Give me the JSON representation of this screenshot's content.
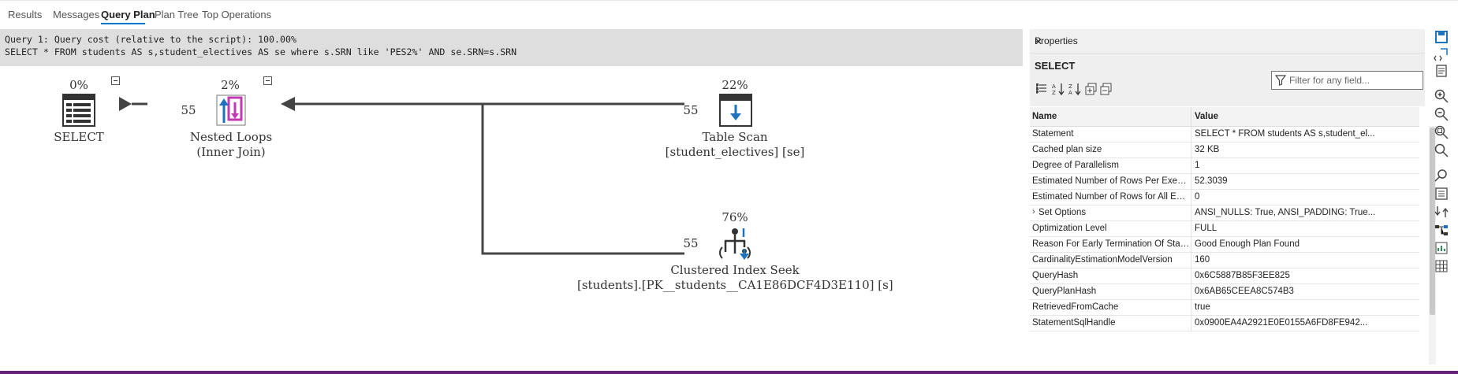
{
  "tabs": [
    {
      "label": "Results"
    },
    {
      "label": "Messages"
    },
    {
      "label": "Query Plan",
      "active": true
    },
    {
      "label": "Plan Tree"
    },
    {
      "label": "Top Operations"
    }
  ],
  "query": {
    "line1": "Query 1: Query cost (relative to the script): 100.00%",
    "line2": "SELECT * FROM students AS s,student_electives AS se where s.SRN like 'PES2%' AND se.SRN=s.SRN"
  },
  "plan": {
    "nodes": {
      "select": {
        "cost": "0%",
        "label": "SELECT",
        "icon": "select-icon"
      },
      "nested_loops": {
        "cost": "2%",
        "label1": "Nested Loops",
        "label2": "(Inner Join)",
        "icon": "nested-loops-icon"
      },
      "table_scan": {
        "cost": "22%",
        "label1": "Table Scan",
        "label2": "[student_electives] [se]",
        "icon": "table-scan-icon"
      },
      "index_seek": {
        "cost": "76%",
        "label1": "Clustered Index Seek",
        "label2": "[students].[PK__students__CA1E86DCF4D3E110] [s]",
        "icon": "clustered-index-seek-icon"
      }
    },
    "edges": {
      "nl_to_select": "55",
      "scan_to_nl": "55",
      "seek_to_nl": "55"
    }
  },
  "properties": {
    "title": "Properties",
    "object": "SELECT",
    "filter_placeholder": "Filter for any field...",
    "col_name": "Name",
    "col_value": "Value",
    "rows": [
      {
        "name": "Statement",
        "value": "SELECT * FROM students AS s,student_el..."
      },
      {
        "name": "Cached plan size",
        "value": "32 KB"
      },
      {
        "name": "Degree of Parallelism",
        "value": "1"
      },
      {
        "name": "Estimated Number of Rows Per Execution",
        "value": "52.3039"
      },
      {
        "name": "Estimated Number of Rows for All Execut...",
        "value": "0"
      },
      {
        "name": "Set Options",
        "value": "ANSI_NULLS: True, ANSI_PADDING: True...",
        "expandable": true
      },
      {
        "name": "Optimization Level",
        "value": "FULL"
      },
      {
        "name": "Reason For Early Termination Of Stateme...",
        "value": "Good Enough Plan Found"
      },
      {
        "name": "CardinalityEstimationModelVersion",
        "value": "160"
      },
      {
        "name": "QueryHash",
        "value": "0x6C5887B85F3EE825"
      },
      {
        "name": "QueryPlanHash",
        "value": "0x6AB65CEEA8C574B3"
      },
      {
        "name": "RetrievedFromCache",
        "value": "true"
      },
      {
        "name": "StatementSqlHandle",
        "value": "0x0900EA4A2921E0E0155A6FD8FE942..."
      }
    ]
  },
  "colors": {
    "accent": "#0078d4",
    "status_bar": "#68217a",
    "nested_loops_magenta": "#c239b3"
  }
}
